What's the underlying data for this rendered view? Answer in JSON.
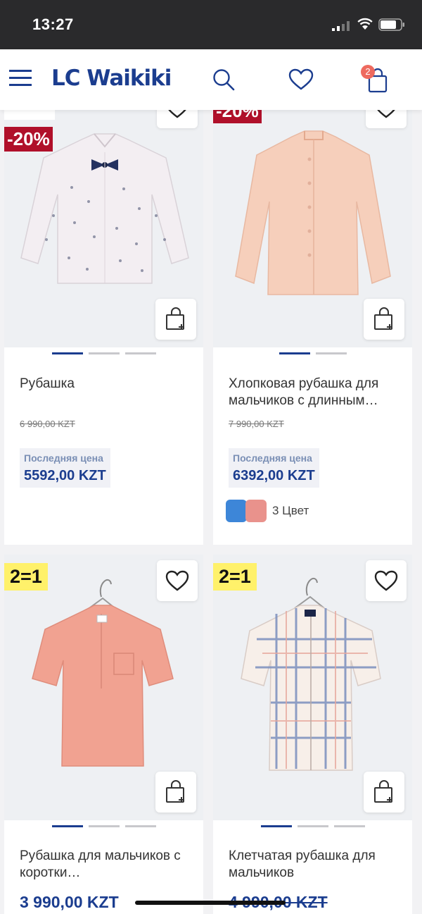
{
  "status_bar": {
    "time": "13:27"
  },
  "header": {
    "brand": "LC Waikiki",
    "cart_count": "2"
  },
  "products": [
    {
      "badge": "-20%",
      "title": "Рубашка",
      "old_price": "6 990,00 KZT",
      "price_label": "Последняя цена",
      "price": "5592,00 KZT",
      "colors_label": ""
    },
    {
      "badge": "-20%",
      "title": "Хлопковая рубашка для мальчиков с длинным…",
      "old_price": "7 990,00 KZT",
      "price_label": "Последняя цена",
      "price": "6392,00 KZT",
      "colors_label": "3 Цвет",
      "swatch_colors": [
        "#3d86d8",
        "#e9928c"
      ]
    },
    {
      "badge": "2=1",
      "title": "Рубашка для мальчиков с коротки…",
      "price": "3 990,00 KZT"
    },
    {
      "badge": "2=1",
      "title": "Клетчатая рубашка для мальчиков",
      "price": "4 990,00 KZT"
    }
  ],
  "colors": {
    "brand_blue": "#1b3d8f",
    "discount_red": "#b0102a",
    "promo_yellow": "#fff16a",
    "badge_coral": "#ee6a5f"
  }
}
